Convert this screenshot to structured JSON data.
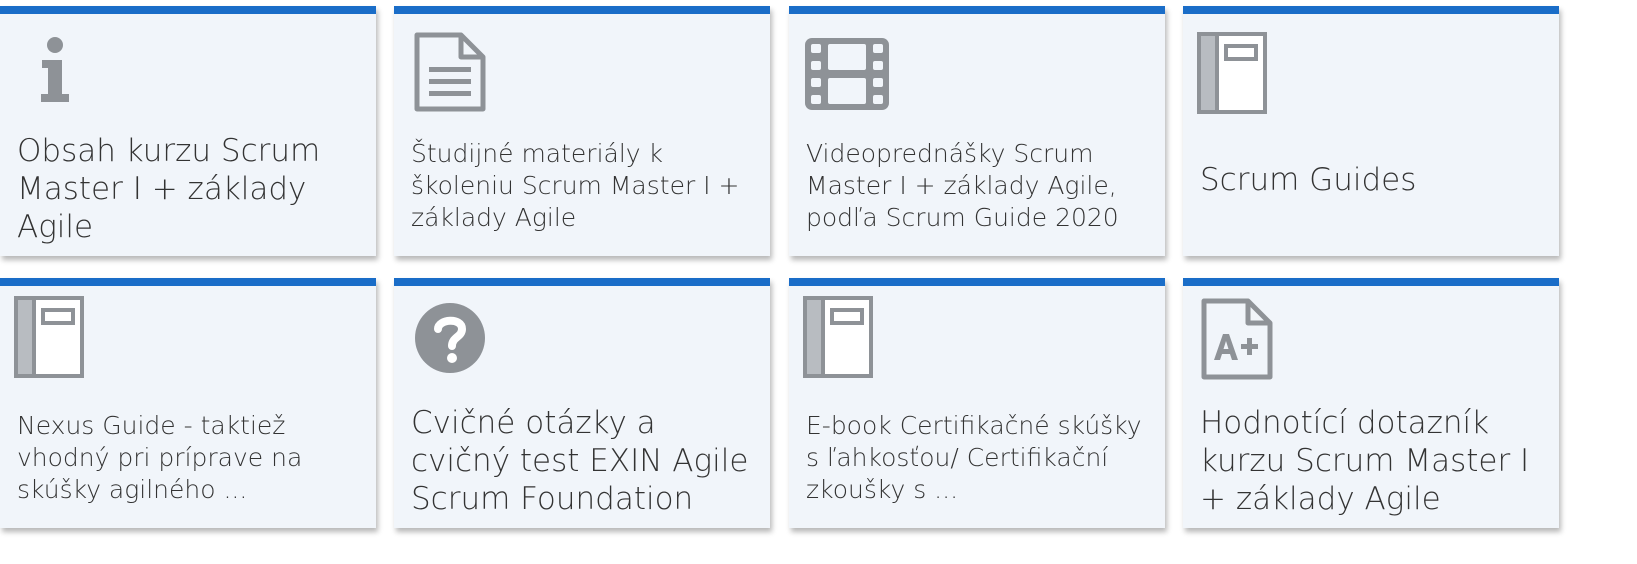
{
  "tiles": [
    {
      "label": "Obsah kurzu Scrum Master I + základy Agile",
      "icon": "info-icon"
    },
    {
      "label": "Študijné materiály k školeniu Scrum Master I + základy Agile",
      "icon": "document-icon"
    },
    {
      "label": "Videoprednášky Scrum Master I + základy Agile, podľa Scrum Guide 2020",
      "icon": "film-icon"
    },
    {
      "label": "Scrum Guides",
      "icon": "book-icon"
    },
    {
      "label": "Nexus Guide - taktiež vhodný pri príprave na skúšky agilného ...",
      "icon": "book-icon"
    },
    {
      "label": "Cvičné otázky a cvičný test EXIN Agile Scrum Foundation",
      "icon": "question-icon"
    },
    {
      "label": "E-book Certifikačné skúšky s ľahkosťou/ Certifikační zkoušky s ...",
      "icon": "book-icon"
    },
    {
      "label": "Hodnotící dotazník kurzu Scrum Master I + základy Agile",
      "icon": "grade-a-plus-icon"
    }
  ],
  "colors": {
    "accent": "#1a6dc8",
    "tile_background": "#f1f5fa",
    "icon": "#8e9297",
    "text": "#333333"
  }
}
